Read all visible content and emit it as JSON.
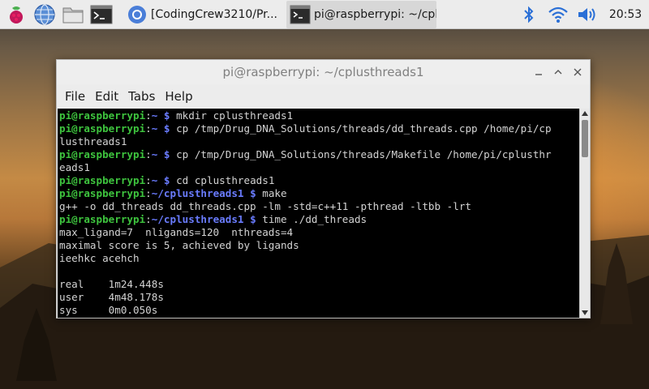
{
  "taskbar": {
    "apps": [
      {
        "name": "raspberry-menu",
        "icon": "raspberry-icon"
      },
      {
        "name": "web-browser",
        "icon": "globe-icon"
      },
      {
        "name": "file-manager",
        "icon": "folder-icon"
      },
      {
        "name": "terminal",
        "icon": "terminal-icon"
      }
    ],
    "tasks": [
      {
        "label": "[CodingCrew3210/Pr...",
        "icon": "chrome-icon"
      },
      {
        "label": "pi@raspberrypi: ~/cpl...",
        "icon": "terminal-icon"
      }
    ],
    "clock": "20:53"
  },
  "window": {
    "title": "pi@raspberrypi: ~/cplusthreads1",
    "menu": [
      "File",
      "Edit",
      "Tabs",
      "Help"
    ]
  },
  "terminal": {
    "lines": [
      [
        {
          "t": "pi@raspberrypi",
          "c": "g"
        },
        {
          "t": ":",
          "c": ""
        },
        {
          "t": "~ $",
          "c": "b"
        },
        {
          "t": " mkdir cplusthreads1",
          "c": ""
        }
      ],
      [
        {
          "t": "pi@raspberrypi",
          "c": "g"
        },
        {
          "t": ":",
          "c": ""
        },
        {
          "t": "~ $",
          "c": "b"
        },
        {
          "t": " cp /tmp/Drug_DNA_Solutions/threads/dd_threads.cpp /home/pi/cp",
          "c": ""
        }
      ],
      [
        {
          "t": "lusthreads1",
          "c": ""
        }
      ],
      [
        {
          "t": "pi@raspberrypi",
          "c": "g"
        },
        {
          "t": ":",
          "c": ""
        },
        {
          "t": "~ $",
          "c": "b"
        },
        {
          "t": " cp /tmp/Drug_DNA_Solutions/threads/Makefile /home/pi/cplusthr",
          "c": ""
        }
      ],
      [
        {
          "t": "eads1",
          "c": ""
        }
      ],
      [
        {
          "t": "pi@raspberrypi",
          "c": "g"
        },
        {
          "t": ":",
          "c": ""
        },
        {
          "t": "~ $",
          "c": "b"
        },
        {
          "t": " cd cplusthreads1",
          "c": ""
        }
      ],
      [
        {
          "t": "pi@raspberrypi",
          "c": "g"
        },
        {
          "t": ":",
          "c": ""
        },
        {
          "t": "~/cplusthreads1 $",
          "c": "b"
        },
        {
          "t": " make",
          "c": ""
        }
      ],
      [
        {
          "t": "g++ -o dd_threads dd_threads.cpp -lm -std=c++11 -pthread -ltbb -lrt",
          "c": ""
        }
      ],
      [
        {
          "t": "pi@raspberrypi",
          "c": "g"
        },
        {
          "t": ":",
          "c": ""
        },
        {
          "t": "~/cplusthreads1 $",
          "c": "b"
        },
        {
          "t": " time ./dd_threads",
          "c": ""
        }
      ],
      [
        {
          "t": "max_ligand=7  nligands=120  nthreads=4",
          "c": ""
        }
      ],
      [
        {
          "t": "maximal score is 5, achieved by ligands",
          "c": ""
        }
      ],
      [
        {
          "t": "ieehkc acehch",
          "c": ""
        }
      ],
      [
        {
          "t": "",
          "c": ""
        }
      ],
      [
        {
          "t": "real    1m24.448s",
          "c": ""
        }
      ],
      [
        {
          "t": "user    4m48.178s",
          "c": ""
        }
      ],
      [
        {
          "t": "sys     0m0.050s",
          "c": ""
        }
      ]
    ]
  }
}
